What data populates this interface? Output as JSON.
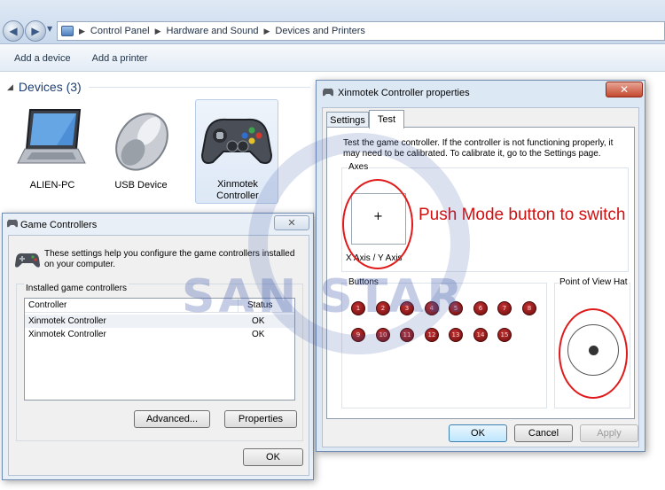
{
  "explorer": {
    "breadcrumb": [
      "Control Panel",
      "Hardware and Sound",
      "Devices and Printers"
    ],
    "commands": [
      "Add a device",
      "Add a printer"
    ],
    "section_title": "Devices (3)",
    "devices": [
      {
        "label": "ALIEN-PC",
        "icon": "laptop-icon"
      },
      {
        "label": "USB Device",
        "icon": "mouse-icon"
      },
      {
        "label": "Xinmotek Controller",
        "icon": "gamepad-icon",
        "selected": true
      }
    ]
  },
  "watermark": {
    "text": "SAN STAR",
    "color": "#3c5aaa"
  },
  "game_controllers": {
    "title": "Game Controllers",
    "close_label": "✕",
    "description": "These settings help you configure the game controllers installed on your computer.",
    "group_label": "Installed game controllers",
    "columns": [
      "Controller",
      "Status"
    ],
    "rows": [
      {
        "controller": "Xinmotek Controller",
        "status": "OK"
      },
      {
        "controller": "Xinmotek Controller",
        "status": "OK"
      }
    ],
    "advanced_label": "Advanced...",
    "properties_label": "Properties",
    "ok_label": "OK"
  },
  "properties": {
    "title": "Xinmotek Controller properties",
    "close_label": "✕",
    "tabs": [
      "Settings",
      "Test"
    ],
    "active_tab": "Test",
    "test_text": "Test the game controller.  If the controller is not functioning properly, it may need to be calibrated.  To calibrate it, go to the Settings page.",
    "axes_label": "Axes",
    "axes_caption": "X Axis / Y Axis",
    "crosshair": "+",
    "buttons_label": "Buttons",
    "buttons": [
      "1",
      "2",
      "3",
      "4",
      "5",
      "6",
      "7",
      "8",
      "9",
      "10",
      "11",
      "12",
      "13",
      "14",
      "15"
    ],
    "pov_label": "Point of View Hat",
    "ok_label": "OK",
    "cancel_label": "Cancel",
    "apply_label": "Apply"
  },
  "annotation": {
    "text": "Push Mode button to switch",
    "color": "#d10f0f"
  }
}
